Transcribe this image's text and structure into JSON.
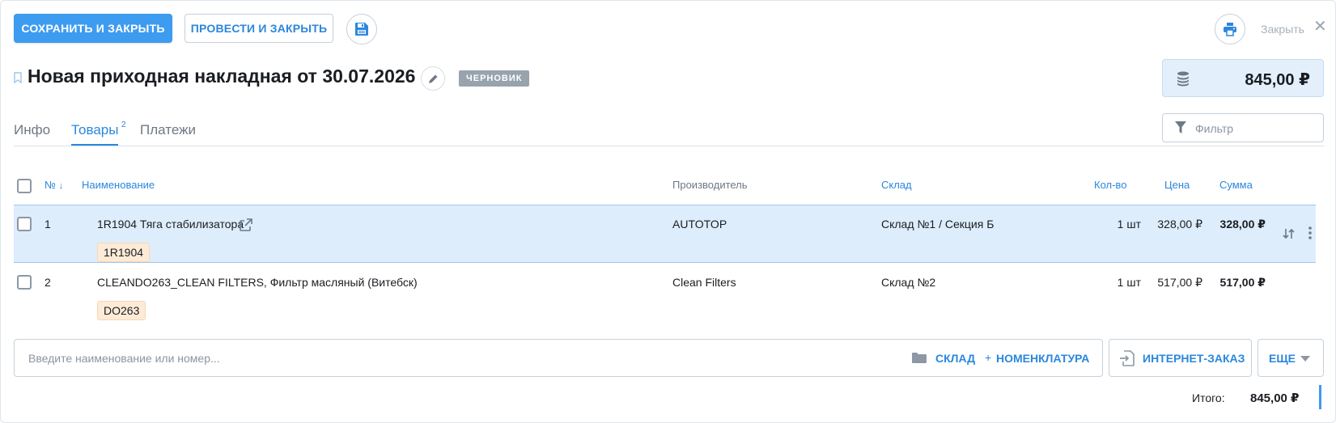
{
  "toolbar": {
    "save_close_label": "СОХРАНИТЬ И ЗАКРЫТЬ",
    "post_close_label": "ПРОВЕСТИ И ЗАКРЫТЬ",
    "close_label": "Закрыть",
    "save_icon": "floppy-disk-icon",
    "print_icon": "printer-icon",
    "close_icon": "close-icon"
  },
  "document": {
    "title": "Новая приходная накладная от 30.07.2026",
    "status_badge": "ЧЕРНОВИК",
    "total": "845,00 ₽"
  },
  "tabs": [
    {
      "label": "Инфо",
      "active": false
    },
    {
      "label": "Товары",
      "active": true,
      "count": "2"
    },
    {
      "label": "Платежи",
      "active": false
    }
  ],
  "filter": {
    "placeholder": "Фильтр"
  },
  "table": {
    "columns": {
      "number": "№",
      "name": "Наименование",
      "manufacturer": "Производитель",
      "warehouse": "Склад",
      "qty": "Кол-во",
      "price": "Цена",
      "sum": "Сумма"
    },
    "rows": [
      {
        "number": "1",
        "name": "1R1904 Тяга стабилизатора",
        "article": "1R1904",
        "manufacturer": "AUTOTOP",
        "warehouse": "Склад №1 / Секция Б",
        "qty": "1 шт",
        "price": "328,00 ₽",
        "sum": "328,00 ₽",
        "selected": true
      },
      {
        "number": "2",
        "name": "CLEANDO263_CLEAN FILTERS, Фильтр масляный (Витебск)",
        "article": "DO263",
        "manufacturer": "Clean Filters",
        "warehouse": "Склад №2",
        "qty": "1 шт",
        "price": "517,00 ₽",
        "sum": "517,00 ₽",
        "selected": false
      }
    ]
  },
  "addbar": {
    "placeholder": "Введите наименование или номер...",
    "warehouse_link": "СКЛАД",
    "plus": "+",
    "nomenclature_link": "НОМЕНКЛАТУРА",
    "internet_order": "ИНТЕРНЕТ-ЗАКАЗ",
    "more": "ЕЩЕ"
  },
  "footer": {
    "total_label": "Итого:",
    "total_value": "845,00 ₽"
  },
  "colors": {
    "accent": "#3d9bf0",
    "link": "#2b87dd",
    "selected_row": "#deedfb",
    "badge": "#98a3ae",
    "article_tag": "#fdebd7"
  }
}
